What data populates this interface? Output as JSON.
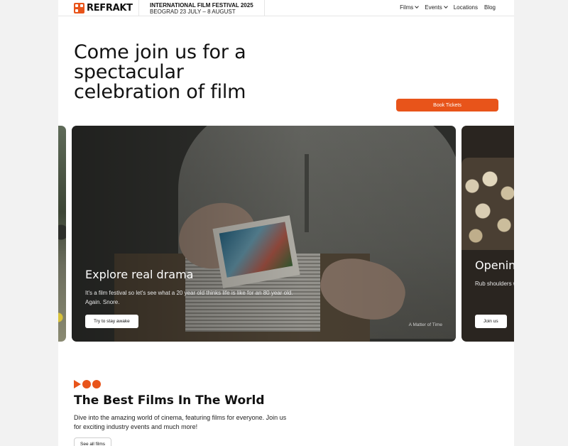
{
  "header": {
    "logo_text": "REFRAKT",
    "festival_title": "INTERNATIONAL FILM FESTIVAL 2025",
    "festival_dates": "BEOGRAD 23 JULY – 8 AUGUST",
    "nav": [
      {
        "label": "Films",
        "dropdown": true
      },
      {
        "label": "Events",
        "dropdown": true
      },
      {
        "label": "Locations",
        "dropdown": false
      },
      {
        "label": "Blog",
        "dropdown": false
      }
    ]
  },
  "hero": {
    "title": "Come join us for a spectacular celebration of film",
    "book_button": "Book Tickets"
  },
  "carousel": {
    "main": {
      "title": "Explore real drama",
      "description": "It's a film festival so let's see what a 20 year old thinks life is like for an 80 year old. Again. Snore.",
      "button": "Try to stay awake",
      "caption": "A Matter of Time"
    },
    "next": {
      "title": "Opening",
      "description": "Rub shoulders with illicit substances absolutely epic",
      "button": "Join us"
    }
  },
  "section": {
    "title": "The Best Films In The World",
    "description": "Dive into the amazing world of cinema, featuring films for everyone. Join us for exciting industry events and much more!",
    "button": "See all films"
  },
  "colors": {
    "accent": "#e8541a",
    "background": "#f2f2f2",
    "panel": "#ffffff"
  },
  "icons": {
    "dropdown": "chevron-down-icon",
    "logo": "refrakt-logo-icon",
    "decoration": [
      "play-triangle-icon",
      "circle-icon",
      "circle-icon"
    ]
  }
}
